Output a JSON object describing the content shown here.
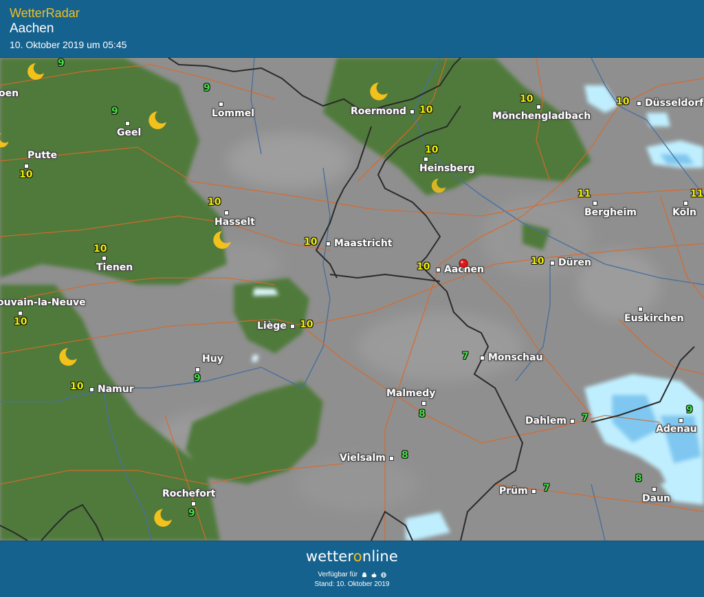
{
  "header": {
    "app_name": "WetterRadar",
    "location": "Aachen",
    "timestamp": "10. Oktober 2019 um 05:45"
  },
  "map": {
    "type": "weather-radar-map",
    "cities": [
      {
        "name": "Lommel"
      },
      {
        "name": "Geel"
      },
      {
        "name": "Putte"
      },
      {
        "name": "Roermond"
      },
      {
        "name": "Mönchengladbach"
      },
      {
        "name": "Düsseldorf"
      },
      {
        "name": "Heinsberg"
      },
      {
        "name": "Hasselt"
      },
      {
        "name": "Maastricht"
      },
      {
        "name": "Tienen"
      },
      {
        "name": "Bergheim"
      },
      {
        "name": "Köln"
      },
      {
        "name": "Aachen"
      },
      {
        "name": "Düren"
      },
      {
        "name": "ouvain-la-Neuve"
      },
      {
        "name": "Liège"
      },
      {
        "name": "Euskirchen"
      },
      {
        "name": "Huy"
      },
      {
        "name": "Monschau"
      },
      {
        "name": "Namur"
      },
      {
        "name": "Malmedy"
      },
      {
        "name": "Dahlem"
      },
      {
        "name": "Adenau"
      },
      {
        "name": "Vielsalm"
      },
      {
        "name": "Prüm"
      },
      {
        "name": "Rochefort"
      },
      {
        "name": "Daun"
      },
      {
        "name": "oen"
      }
    ],
    "temperatures": [
      {
        "value": "9",
        "color": "green"
      },
      {
        "value": "9",
        "color": "green"
      },
      {
        "value": "9",
        "color": "green"
      },
      {
        "value": "10",
        "color": "yellow"
      },
      {
        "value": "10",
        "color": "yellow"
      },
      {
        "value": "10",
        "color": "yellow"
      },
      {
        "value": "10",
        "color": "yellow"
      },
      {
        "value": "10",
        "color": "yellow"
      },
      {
        "value": "10",
        "color": "yellow"
      },
      {
        "value": "10",
        "color": "yellow"
      },
      {
        "value": "11",
        "color": "yellow"
      },
      {
        "value": "11",
        "color": "yellow"
      },
      {
        "value": "10",
        "color": "yellow"
      },
      {
        "value": "10",
        "color": "yellow"
      },
      {
        "value": "10",
        "color": "yellow"
      },
      {
        "value": "10",
        "color": "yellow"
      },
      {
        "value": "10",
        "color": "yellow"
      },
      {
        "value": "9",
        "color": "green"
      },
      {
        "value": "7",
        "color": "green"
      },
      {
        "value": "10",
        "color": "yellow"
      },
      {
        "value": "8",
        "color": "green"
      },
      {
        "value": "7",
        "color": "green"
      },
      {
        "value": "9",
        "color": "green"
      },
      {
        "value": "8",
        "color": "green"
      },
      {
        "value": "7",
        "color": "green"
      },
      {
        "value": "9",
        "color": "green"
      },
      {
        "value": "8",
        "color": "green"
      }
    ],
    "marker_location": "Aachen",
    "colors": {
      "land": "#8f8f8f",
      "forest": "#4f7a3a",
      "rain_light": "#bfefff",
      "rain": "#7fc7f0",
      "border": "#2a2a2a",
      "road": "#d9692a",
      "river": "#4a6f9e",
      "temp_warm": "#f1f000",
      "temp_cool": "#45e043",
      "moon": "#f3c01c"
    }
  },
  "footer": {
    "brand_prefix": "wetter",
    "brand_o": "o",
    "brand_suffix": "nline",
    "available_text": "Verfügbar für",
    "platforms": [
      "android-icon",
      "apple-icon",
      "web-icon"
    ],
    "stand": "Stand: 10. Oktober 2019"
  }
}
